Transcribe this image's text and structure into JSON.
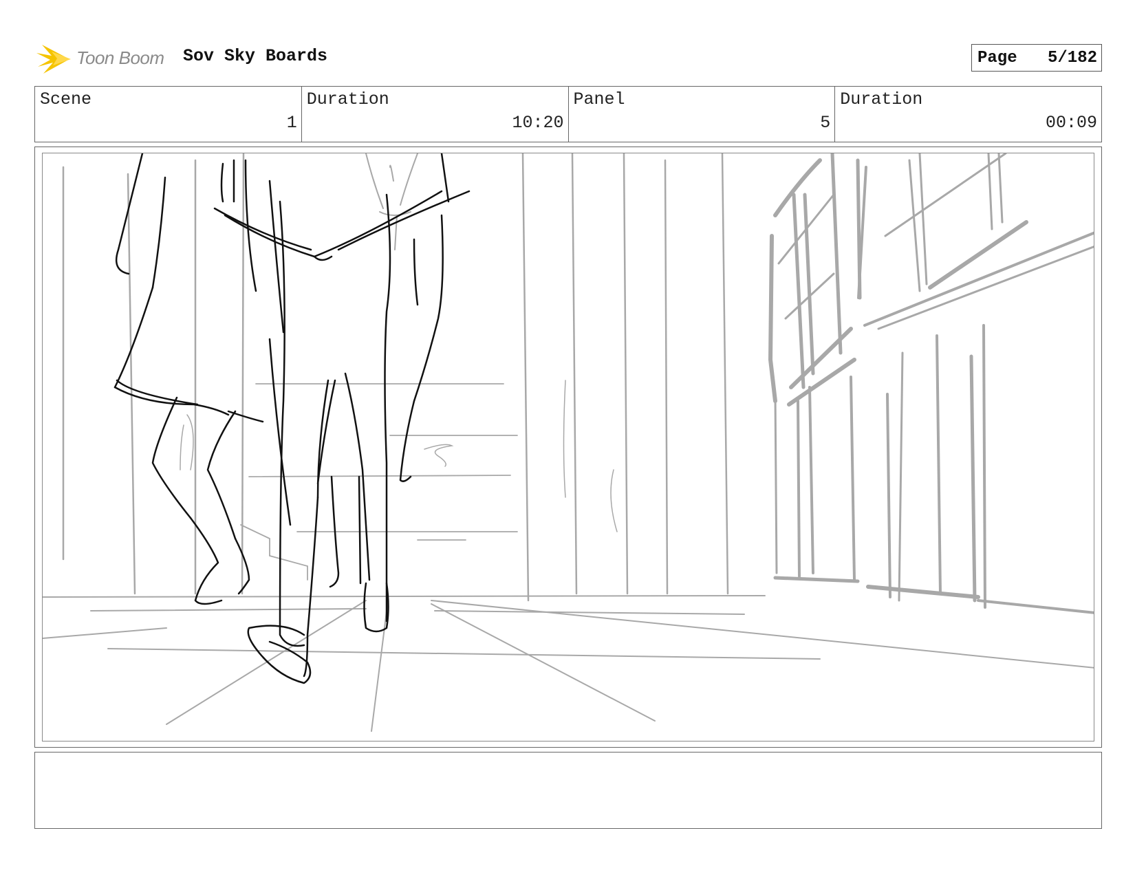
{
  "header": {
    "logo_text": "Toon Boom",
    "project_title": "Sov Sky Boards",
    "page_label": "Page",
    "page_value": "5/182"
  },
  "info": {
    "scene_label": "Scene",
    "scene_value": "1",
    "scene_duration_label": "Duration",
    "scene_duration_value": "10:20",
    "panel_label": "Panel",
    "panel_value": "5",
    "panel_duration_label": "Duration",
    "panel_duration_value": "00:09"
  },
  "notes": {
    "text": ""
  },
  "colors": {
    "logo_accent": "#f5c400",
    "sketch_dark": "#111111",
    "sketch_light": "#a8a8a8"
  }
}
